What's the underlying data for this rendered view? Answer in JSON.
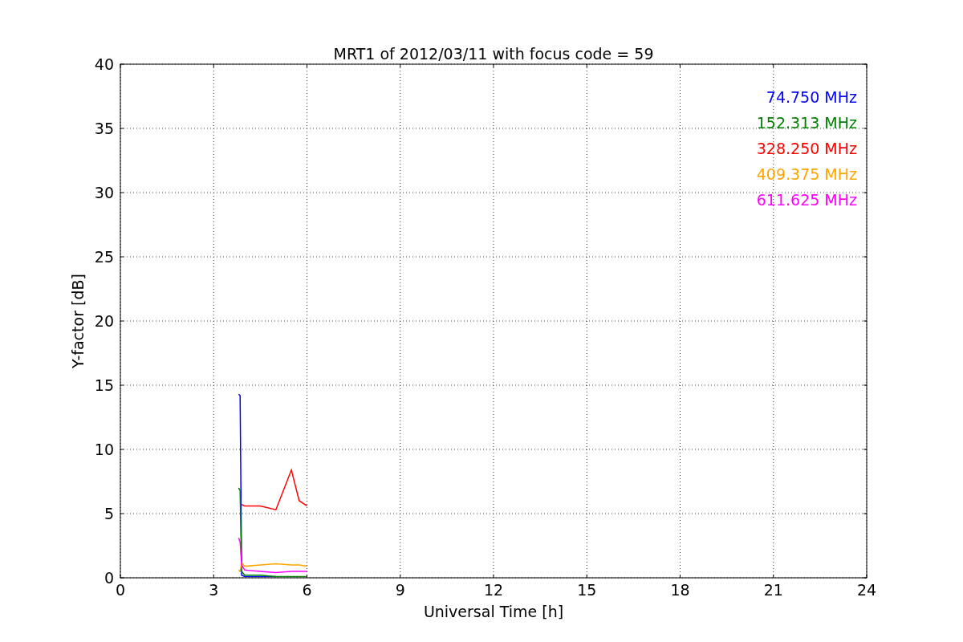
{
  "chart_data": {
    "type": "line",
    "title": "MRT1 of 2012/03/11 with focus code = 59",
    "xlabel": "Universal Time [h]",
    "ylabel": "Y-factor [dB]",
    "x": [
      3.8,
      3.85,
      3.9,
      4.0,
      4.5,
      5.0,
      5.5,
      5.75,
      6.0
    ],
    "series": [
      {
        "name": "74.750 MHz",
        "color": "#0000ff",
        "values": [
          14.3,
          14.2,
          0.2,
          0.1,
          0.1,
          0.1,
          null,
          null,
          null
        ]
      },
      {
        "name": "152.313 MHz",
        "color": "#008000",
        "values": [
          7.0,
          6.8,
          0.5,
          0.2,
          0.2,
          0.1,
          0.1,
          0.1,
          0.1
        ]
      },
      {
        "name": "328.250 MHz",
        "color": "#ff0000",
        "values": [
          null,
          null,
          5.7,
          5.6,
          5.6,
          5.3,
          8.4,
          6.0,
          5.6
        ]
      },
      {
        "name": "409.375 MHz",
        "color": "#ffa500",
        "values": [
          0.6,
          0.5,
          1.2,
          0.9,
          1.0,
          1.1,
          1.0,
          1.0,
          0.9
        ]
      },
      {
        "name": "611.625 MHz",
        "color": "#ff00ff",
        "values": [
          3.1,
          2.8,
          1.0,
          0.6,
          0.5,
          0.4,
          0.5,
          0.5,
          0.5
        ]
      }
    ],
    "xlim": [
      0,
      24
    ],
    "ylim": [
      0,
      40
    ],
    "xticks": [
      0,
      3,
      6,
      9,
      12,
      15,
      18,
      21,
      24
    ],
    "yticks": [
      0,
      5,
      10,
      15,
      20,
      25,
      30,
      35,
      40
    ],
    "grid": true
  }
}
